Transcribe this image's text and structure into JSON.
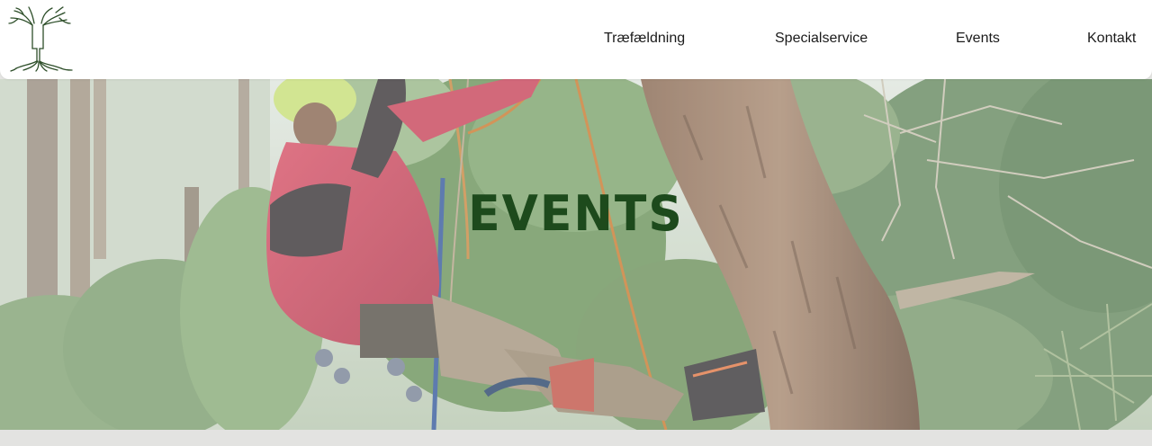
{
  "header": {
    "logo_icon": "tree-roots-logo-icon",
    "nav": [
      {
        "label": "Træfældning"
      },
      {
        "label": "Specialservice"
      },
      {
        "label": "Events"
      },
      {
        "label": "Kontakt"
      }
    ]
  },
  "hero": {
    "title": "EVENTS",
    "image": "arborist-climbing-tree-photo",
    "title_color": "#1d4a1c"
  },
  "colors": {
    "header_bg": "#ffffff",
    "nav_text": "#1b1b1b",
    "page_bg": "#e3e3e1"
  }
}
